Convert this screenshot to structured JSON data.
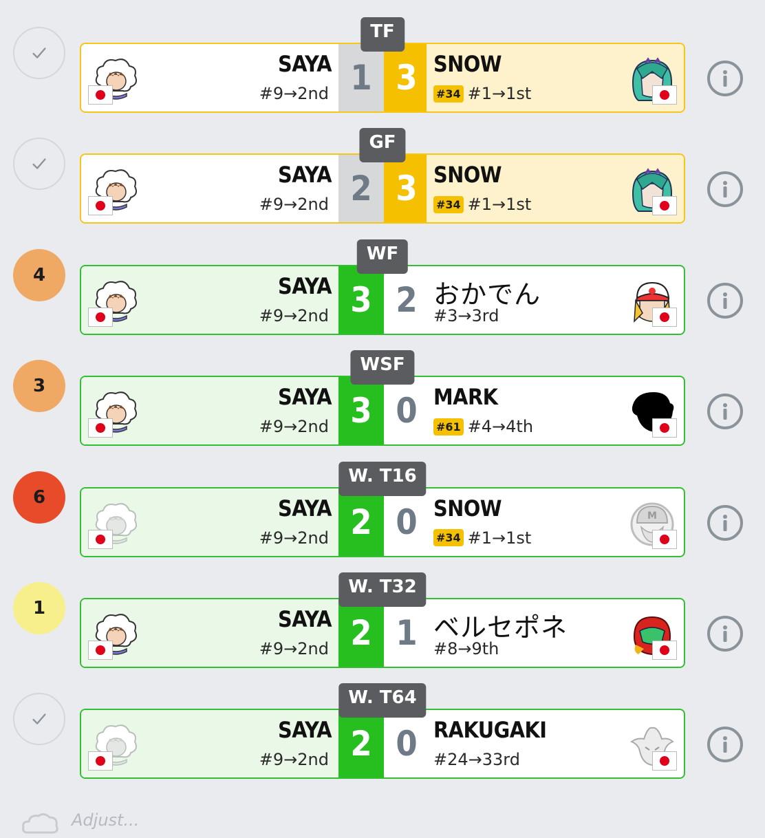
{
  "matches": [
    {
      "badge_type": "check",
      "badge_text": "",
      "round": "TF",
      "status": "lost",
      "left": {
        "name": "SAYA",
        "seed": "#9→2nd",
        "rank": "",
        "score": "1",
        "score_style": "s-gray",
        "char": "iceclimbers"
      },
      "right": {
        "name": "SNOW",
        "seed": "#1→1st",
        "rank": "#34",
        "score": "3",
        "score_style": "s-yellow",
        "char": "byleth",
        "jp": false
      }
    },
    {
      "badge_type": "check",
      "badge_text": "",
      "round": "GF",
      "status": "lost",
      "left": {
        "name": "SAYA",
        "seed": "#9→2nd",
        "rank": "",
        "score": "2",
        "score_style": "s-gray",
        "char": "iceclimbers"
      },
      "right": {
        "name": "SNOW",
        "seed": "#1→1st",
        "rank": "#34",
        "score": "3",
        "score_style": "s-yellow",
        "char": "byleth",
        "jp": false
      }
    },
    {
      "badge_type": "b4",
      "badge_text": "4",
      "round": "WF",
      "status": "won",
      "left": {
        "name": "SAYA",
        "seed": "#9→2nd",
        "rank": "",
        "score": "3",
        "score_style": "s-green",
        "char": "iceclimbers"
      },
      "right": {
        "name": "おかでん",
        "seed": "#3→3rd",
        "rank": "",
        "score": "2",
        "score_style": "s-white",
        "char": "trainer",
        "jp": true
      }
    },
    {
      "badge_type": "b3",
      "badge_text": "3",
      "round": "WSF",
      "status": "won",
      "left": {
        "name": "SAYA",
        "seed": "#9→2nd",
        "rank": "",
        "score": "3",
        "score_style": "s-green",
        "char": "iceclimbers"
      },
      "right": {
        "name": "MARK",
        "seed": "#4→4th",
        "rank": "#61",
        "score": "0",
        "score_style": "s-white",
        "char": "silhouette",
        "jp": false
      }
    },
    {
      "badge_type": "b6",
      "badge_text": "6",
      "round": "W. T16",
      "status": "won",
      "left": {
        "name": "SAYA",
        "seed": "#9→2nd",
        "rank": "",
        "score": "2",
        "score_style": "s-green",
        "char": "iceclimbers-faded"
      },
      "right": {
        "name": "SNOW",
        "seed": "#1→1st",
        "rank": "#34",
        "score": "0",
        "score_style": "s-white",
        "char": "mario-gray",
        "jp": false
      }
    },
    {
      "badge_type": "b1",
      "badge_text": "1",
      "round": "W. T32",
      "status": "won",
      "left": {
        "name": "SAYA",
        "seed": "#9→2nd",
        "rank": "",
        "score": "2",
        "score_style": "s-green",
        "char": "iceclimbers"
      },
      "right": {
        "name": "ベルセポネ",
        "seed": "#8→9th",
        "rank": "",
        "score": "1",
        "score_style": "s-white",
        "char": "samus",
        "jp": true
      }
    },
    {
      "badge_type": "check",
      "badge_text": "",
      "round": "W. T64",
      "status": "won",
      "left": {
        "name": "SAYA",
        "seed": "#9→2nd",
        "rank": "",
        "score": "2",
        "score_style": "s-green",
        "char": "iceclimbers-faded"
      },
      "right": {
        "name": "RAKUGAKI",
        "seed": "#24→33rd",
        "rank": "",
        "score": "0",
        "score_style": "s-white",
        "char": "ganon-gray",
        "jp": false
      }
    }
  ],
  "footer_text": "Adjust... ",
  "colors": {
    "accent_yellow": "#f5c000",
    "accent_green": "#27bf1f",
    "lost_border": "#f5c518",
    "won_border": "#32bf32"
  }
}
